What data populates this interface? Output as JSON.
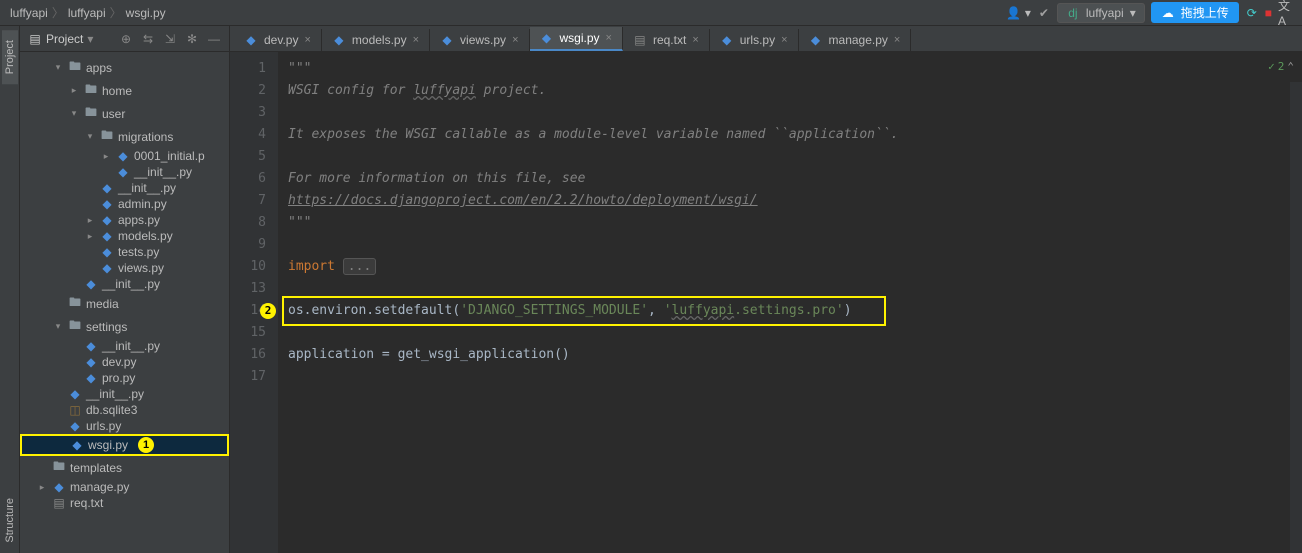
{
  "breadcrumbs": [
    "luffyapi",
    "luffyapi",
    "wsgi.py"
  ],
  "top_right": {
    "project_select": "luffyapi",
    "upload_label": "拖拽上传"
  },
  "side_tabs": {
    "project": "Project",
    "structure": "Structure"
  },
  "project_panel": {
    "title": "Project",
    "tree": [
      {
        "indent": 2,
        "arrow": "v",
        "icon": "folder",
        "label": "apps"
      },
      {
        "indent": 3,
        "arrow": ">",
        "icon": "folder",
        "label": "home"
      },
      {
        "indent": 3,
        "arrow": "v",
        "icon": "folder",
        "label": "user"
      },
      {
        "indent": 4,
        "arrow": "v",
        "icon": "folder",
        "label": "migrations"
      },
      {
        "indent": 5,
        "arrow": ">",
        "icon": "py",
        "label": "0001_initial.p"
      },
      {
        "indent": 5,
        "arrow": "",
        "icon": "py",
        "label": "__init__.py"
      },
      {
        "indent": 4,
        "arrow": "",
        "icon": "py",
        "label": "__init__.py"
      },
      {
        "indent": 4,
        "arrow": "",
        "icon": "py",
        "label": "admin.py"
      },
      {
        "indent": 4,
        "arrow": ">",
        "icon": "py",
        "label": "apps.py"
      },
      {
        "indent": 4,
        "arrow": ">",
        "icon": "py",
        "label": "models.py"
      },
      {
        "indent": 4,
        "arrow": "",
        "icon": "py",
        "label": "tests.py"
      },
      {
        "indent": 4,
        "arrow": "",
        "icon": "py",
        "label": "views.py"
      },
      {
        "indent": 3,
        "arrow": "",
        "icon": "py",
        "label": "__init__.py"
      },
      {
        "indent": 2,
        "arrow": "",
        "icon": "folder",
        "label": "media"
      },
      {
        "indent": 2,
        "arrow": "v",
        "icon": "folder",
        "label": "settings"
      },
      {
        "indent": 3,
        "arrow": "",
        "icon": "py",
        "label": "__init__.py"
      },
      {
        "indent": 3,
        "arrow": "",
        "icon": "py",
        "label": "dev.py"
      },
      {
        "indent": 3,
        "arrow": "",
        "icon": "py",
        "label": "pro.py"
      },
      {
        "indent": 2,
        "arrow": "",
        "icon": "py",
        "label": "__init__.py"
      },
      {
        "indent": 2,
        "arrow": "",
        "icon": "db",
        "label": "db.sqlite3"
      },
      {
        "indent": 2,
        "arrow": "",
        "icon": "py",
        "label": "urls.py"
      },
      {
        "indent": 2,
        "arrow": "",
        "icon": "py",
        "label": "wsgi.py",
        "selected": true,
        "annotation": "1"
      },
      {
        "indent": 1,
        "arrow": "",
        "icon": "folder",
        "label": "templates"
      },
      {
        "indent": 1,
        "arrow": ">",
        "icon": "py",
        "label": "manage.py"
      },
      {
        "indent": 1,
        "arrow": "",
        "icon": "txt",
        "label": "req.txt"
      }
    ]
  },
  "tabs": [
    {
      "icon": "py",
      "label": "dev.py",
      "active": false
    },
    {
      "icon": "py",
      "label": "models.py",
      "active": false
    },
    {
      "icon": "py",
      "label": "views.py",
      "active": false
    },
    {
      "icon": "py",
      "label": "wsgi.py",
      "active": true
    },
    {
      "icon": "txt",
      "label": "req.txt",
      "active": false
    },
    {
      "icon": "py",
      "label": "urls.py",
      "active": false
    },
    {
      "icon": "py",
      "label": "manage.py",
      "active": false
    }
  ],
  "editor": {
    "lines": [
      {
        "n": 1,
        "html": "<span class='comment'>\"\"\"</span>"
      },
      {
        "n": 2,
        "html": "<span class='comment'>WSGI config for <span class='underl'>luffyapi</span> project.</span>"
      },
      {
        "n": 3,
        "html": ""
      },
      {
        "n": 4,
        "html": "<span class='comment'>It exposes the WSGI callable as a module-level variable named ``application``.</span>"
      },
      {
        "n": 5,
        "html": ""
      },
      {
        "n": 6,
        "html": "<span class='comment'>For more information on this file, see</span>"
      },
      {
        "n": 7,
        "html": "<span class='link'>https://docs.djangoproject.com/en/2.2/howto/deployment/wsgi/</span>"
      },
      {
        "n": 8,
        "html": "<span class='comment'>\"\"\"</span>"
      },
      {
        "n": 9,
        "html": ""
      },
      {
        "n": 10,
        "html": "<span class='keyword'>import</span> <span class='fold-box'>...</span>"
      },
      {
        "n": 13,
        "html": ""
      },
      {
        "n": 14,
        "html": "os.environ.setdefault(<span class='string'>'DJANGO_SETTINGS_MODULE'</span>, <span class='string'>'<span class='underl'>luffyapi</span>.settings.pro'</span>)",
        "annotation": "2",
        "highlight": true
      },
      {
        "n": 15,
        "html": ""
      },
      {
        "n": 16,
        "html": "application = get_wsgi_application()"
      },
      {
        "n": 17,
        "html": ""
      }
    ],
    "status": {
      "check": "✓",
      "count": "2",
      "caret": "⌃"
    }
  }
}
